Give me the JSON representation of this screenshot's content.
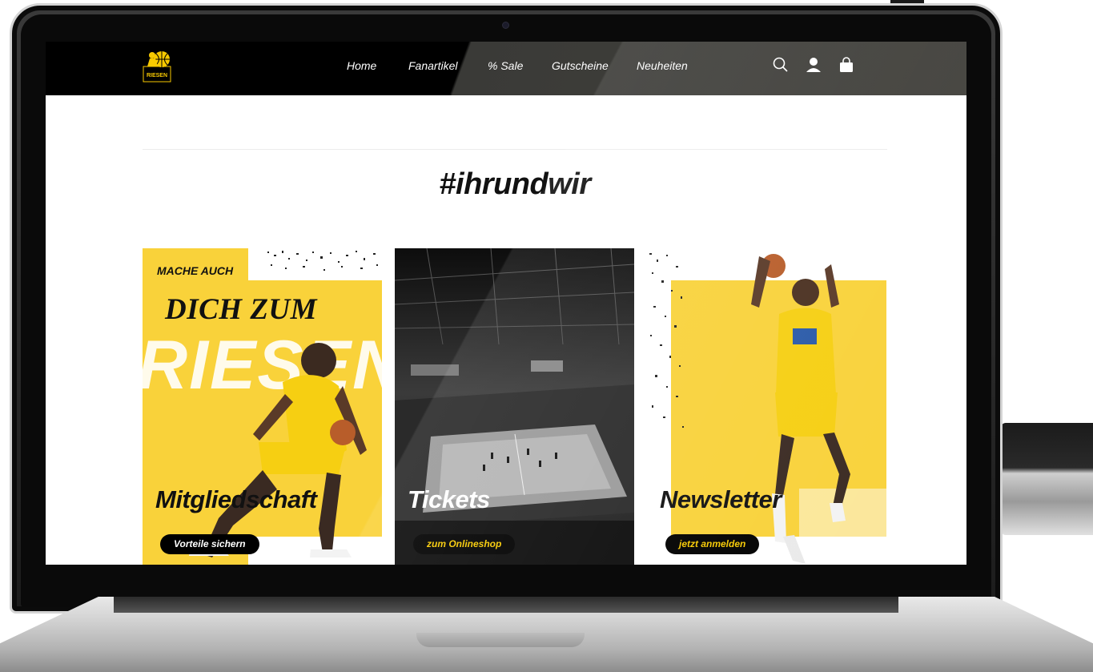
{
  "brand": {
    "logo_text": "RIESEN",
    "accent": "#f7c900"
  },
  "nav": {
    "items": [
      "Home",
      "Fanartikel",
      "% Sale",
      "Gutscheine",
      "Neuheiten"
    ]
  },
  "icons": [
    "search-icon",
    "user-icon",
    "bag-icon"
  ],
  "hero": {
    "hashtag": "#ihrundwir"
  },
  "cards": [
    {
      "kicker": "MACHE AUCH",
      "headline": "DICH ZUM",
      "big_word": "RIESEN",
      "title": "Mitgliedschaft",
      "button": "Vorteile sichern"
    },
    {
      "title": "Tickets",
      "button": "zum Onlineshop"
    },
    {
      "title": "Newsletter",
      "button": "jetzt anmelden"
    }
  ]
}
